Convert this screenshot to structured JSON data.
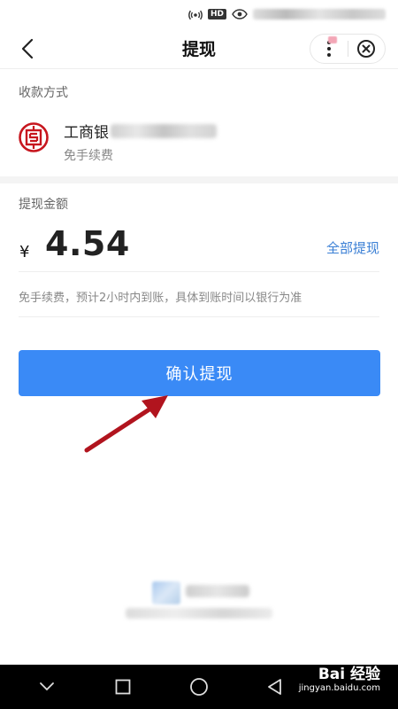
{
  "header": {
    "title": "提现"
  },
  "payee": {
    "section_label": "收款方式",
    "bank_name_visible": "工商银",
    "fee_note": "免手续费"
  },
  "amount": {
    "section_label": "提现金额",
    "currency": "¥",
    "value": "4.54",
    "withdraw_all": "全部提现",
    "arrival_note": "免手续费，预计2小时内到账，具体到账时间以银行为准"
  },
  "confirm_button": {
    "label": "确认提现"
  },
  "watermark": {
    "main": "Bai 经验",
    "url": "jingyan.baidu.com"
  },
  "colors": {
    "accent": "#3a8af6",
    "link": "#3a7fd5",
    "bank_red": "#c7161e",
    "arrow": "#b1141e"
  },
  "icons": {
    "back": "chevron-left-icon",
    "more": "more-vertical-icon",
    "close": "close-circle-icon",
    "bank": "icbc-logo-icon"
  }
}
